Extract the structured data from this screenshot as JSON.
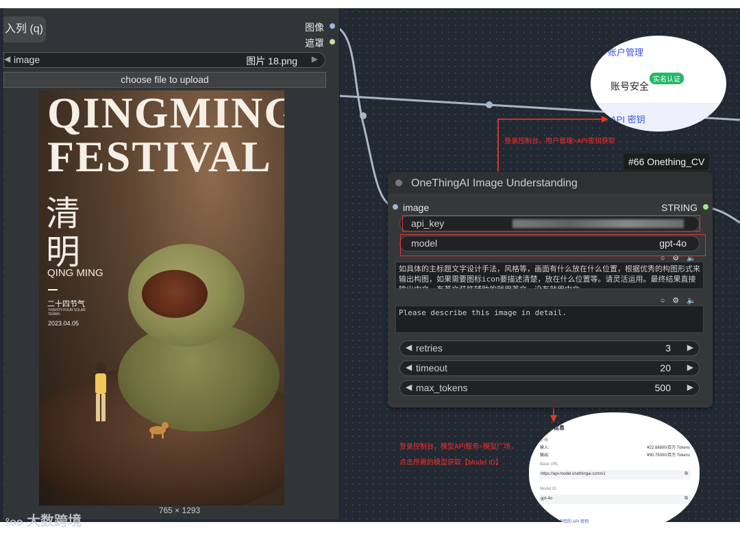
{
  "queue_button": "入列 (q)",
  "outputs": {
    "image": "图像",
    "mask": "遮罩"
  },
  "load_image": {
    "widget_name": "image",
    "widget_value": "图片 18.png",
    "upload_label": "choose file to upload",
    "dimensions": "765 × 1293"
  },
  "poster": {
    "title_line1": "QINGMING",
    "title_line2": "FESTIVAL",
    "cn_line1": "清",
    "cn_line2": "明",
    "en_name": "QING MING",
    "solar_term_cn": "二十四节气",
    "solar_term_en": "TWENTY-FOUR SOLAR TERMS",
    "date": "2023.04.05"
  },
  "node": {
    "tag": "#66 Onething_CV",
    "title": "OneThingAI Image Understanding",
    "input_label": "image",
    "output_label": "STRING",
    "api_key_name": "api_key",
    "model_name": "model",
    "model_value": "gpt-4o",
    "system_prompt": "如具体的主标题文字设计手法，风格等，画面有什么放在什么位置，根据优秀的构图形式来输出构图，如果需要图标icon要描述清楚，放在什么位置等。请灵活运用。最终结果直接输出中文，有英文装饰辅助的就用英文，没有就用中文。",
    "user_prompt": "Please describe this image in detail.",
    "retries_name": "retries",
    "retries_value": "3",
    "timeout_name": "timeout",
    "timeout_value": "20",
    "max_tokens_name": "max_tokens",
    "max_tokens_value": "500"
  },
  "popup_top": {
    "menu": "账户管理",
    "security": "账号安全",
    "verified_badge": "实名认证",
    "api_key_item": "API 密钥"
  },
  "annotations": {
    "top": "登录控制台，用户管理>API密钥获取",
    "bottom_line1": "登录控制台，模型API服务>模型广场，",
    "bottom_line2": "点击所需的模型获取【Model ID】"
  },
  "popup_bottom": {
    "heading": "信息",
    "price_label": "价格",
    "input_label": "输入:",
    "input_price": "¥22.68800/百万 Tokens",
    "output_label": "输出:",
    "output_price": "¥90.75000/百万 Tokens",
    "base_url_label": "Base URL",
    "base_url_value": "https://api-model.onethingai.com/v1",
    "model_id_label": "Model ID",
    "model_id_value": "gpt-4o",
    "key_label": "密钥",
    "key_link": "询您的 API 密钥"
  },
  "watermark": "大数跨境",
  "colors": {
    "canvas": "#222932",
    "node": "#353739",
    "annotation": "#ff2b2b",
    "link_blue": "#4a5fd8",
    "badge_green": "#21b866"
  }
}
